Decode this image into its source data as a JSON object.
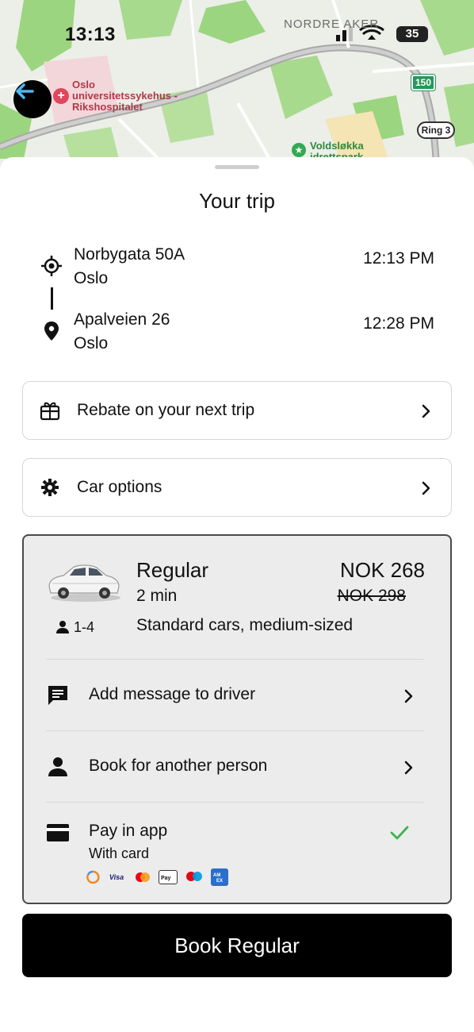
{
  "status_bar": {
    "time": "13:13",
    "battery": "35"
  },
  "map": {
    "area_label": "NORDRE AKER",
    "hospital_label_line1": "Oslo",
    "hospital_label_line2": "universitetssykehus -",
    "hospital_label_line3": "Rikshospitalet",
    "park_label_line1": "Voldsløkka",
    "park_label_line2": "idrettspark",
    "road_150": "150",
    "road_ring": "Ring 3"
  },
  "sheet": {
    "title": "Your trip",
    "pickup": {
      "street": "Norbygata 50A",
      "city": "Oslo",
      "time": "12:13 PM"
    },
    "dropoff": {
      "street": "Apalveien 26",
      "city": "Oslo",
      "time": "12:28 PM"
    },
    "rebate_label": "Rebate on your next trip",
    "car_options_label": "Car options"
  },
  "ride": {
    "name": "Regular",
    "eta": "2 min",
    "price": "NOK 268",
    "old_price": "NOK 298",
    "seats": "1-4",
    "description": "Standard cars, medium-sized",
    "message_label": "Add message to driver",
    "book_other_label": "Book for another person",
    "pay_title": "Pay in app",
    "pay_subtitle": "With card",
    "card_logos": [
      "Visa",
      "Mastercard",
      "Apple Pay",
      "Maestro",
      "Amex"
    ]
  },
  "book_button": "Book Regular",
  "colors": {
    "accent_check": "#3bb54a",
    "back_arrow": "#4cb8f5",
    "button_bg": "#000000"
  }
}
